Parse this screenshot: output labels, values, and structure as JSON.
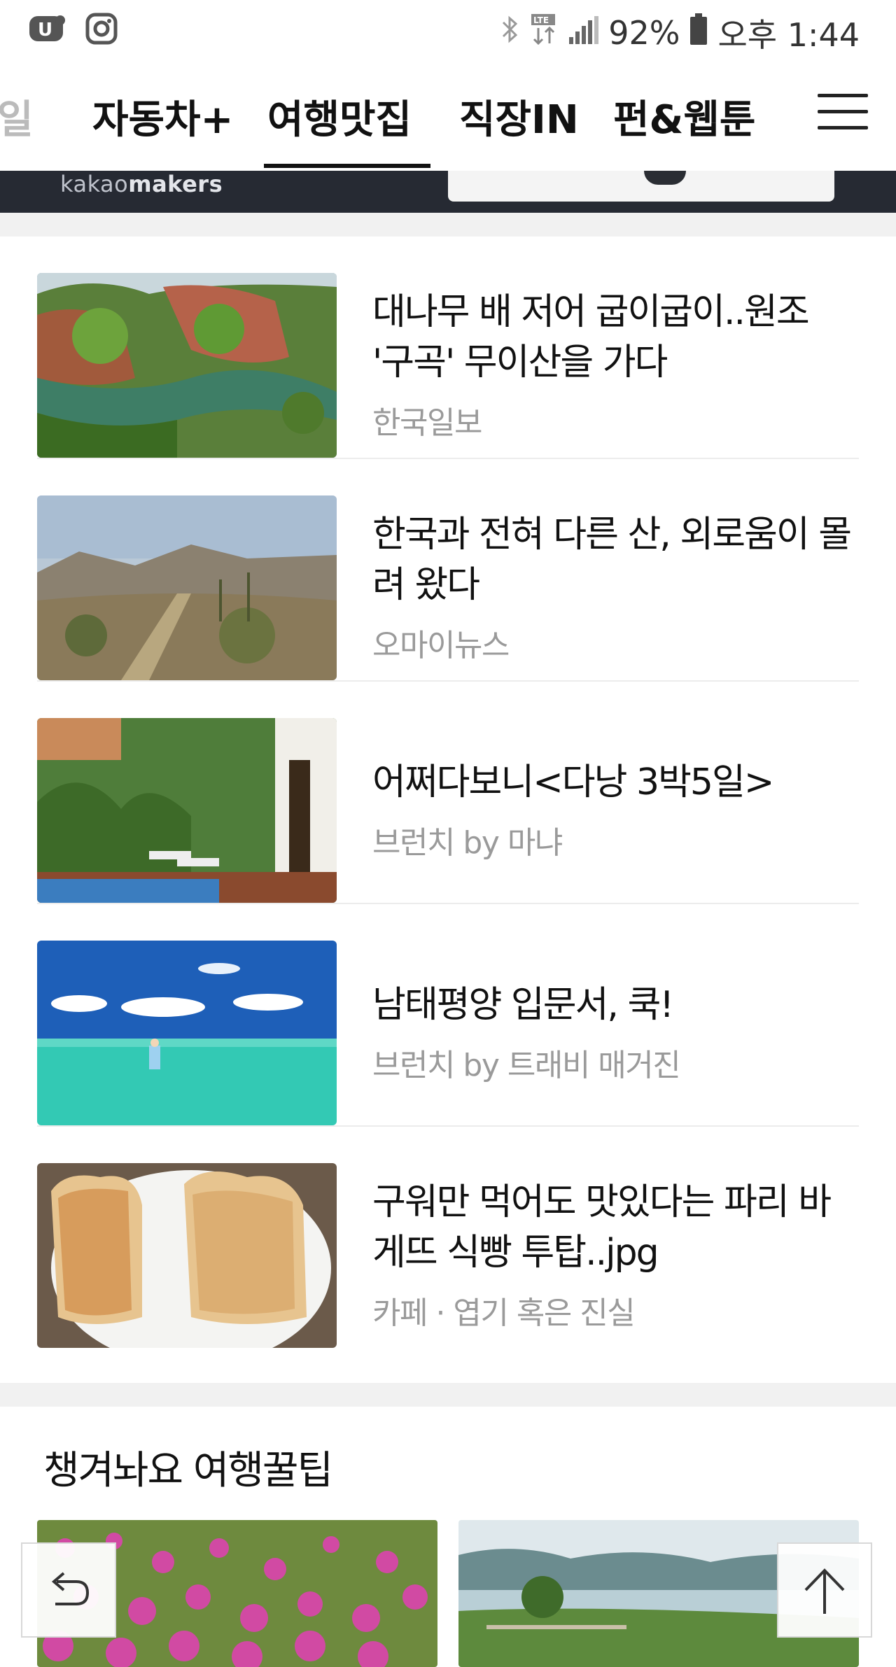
{
  "status_bar": {
    "battery": "92%",
    "time": "오후 1:44",
    "network": "LTE"
  },
  "tabs": [
    {
      "label": "일",
      "faded": true
    },
    {
      "label": "자동차+"
    },
    {
      "label": "여행맛집",
      "active": true
    },
    {
      "label": "직장IN"
    },
    {
      "label": "펀&웹툰"
    }
  ],
  "banner": {
    "brand_prefix": "kakao",
    "brand_suffix": "makers"
  },
  "articles": [
    {
      "title": "대나무 배 저어 굽이굽이..원조 '구곡' 무이산을 가다",
      "source": "한국일보",
      "thumb": "river-canyon"
    },
    {
      "title": "한국과 전혀 다른 산, 외로움이 몰려 왔다",
      "source": "오마이뉴스",
      "thumb": "desert-mountain"
    },
    {
      "title": "어쩌다보니<다낭 3박5일>",
      "source": "브런치 by 마냐",
      "thumb": "pool-villa"
    },
    {
      "title": "남태평양 입문서, 쿡!",
      "source": "브런치 by 트래비 매거진",
      "thumb": "lagoon-fishing"
    },
    {
      "title": "구워만 먹어도 맛있다는 파리 바게뜨 식빵 투탑..jpg",
      "source": "카페 · 엽기 혹은 진실",
      "thumb": "toast-bread"
    }
  ],
  "section": {
    "title": "챙겨놔요 여행꿀팁"
  },
  "buttons": {
    "back": "back-arrow-icon",
    "top": "up-arrow-icon"
  }
}
